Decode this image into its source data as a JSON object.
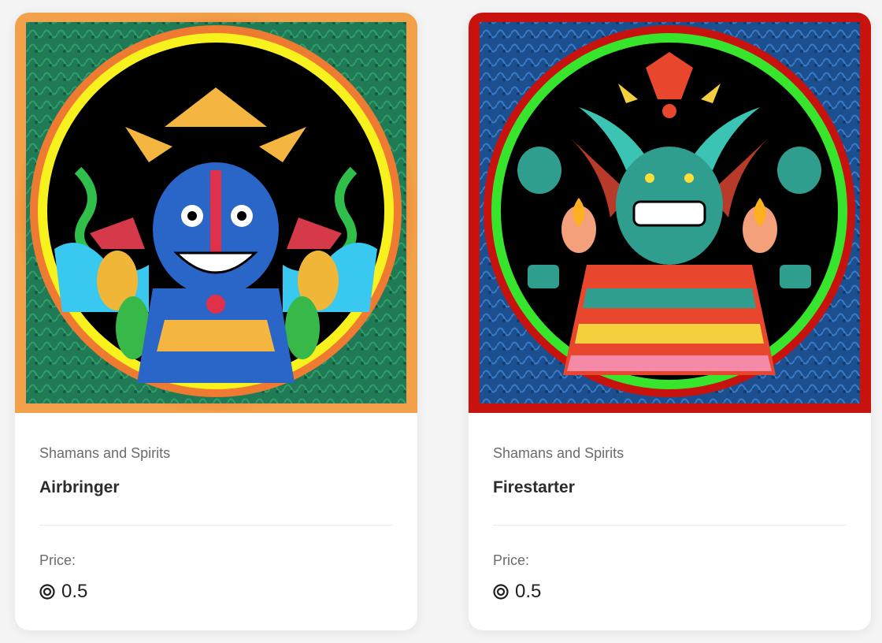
{
  "cards": [
    {
      "collection": "Shamans and Spirits",
      "title": "Airbringer",
      "price_label": "Price:",
      "price": "0.5",
      "currency_icon": "coin-icon",
      "colors": {
        "frame": "#ef7b32",
        "ring": "#f7f21e",
        "pattern": "#1f7a55"
      }
    },
    {
      "collection": "Shamans and Spirits",
      "title": "Firestarter",
      "price_label": "Price:",
      "price": "0.5",
      "currency_icon": "coin-icon",
      "colors": {
        "frame": "#c8120e",
        "ring": "#37e52c",
        "pattern": "#1c4f8f"
      }
    }
  ]
}
